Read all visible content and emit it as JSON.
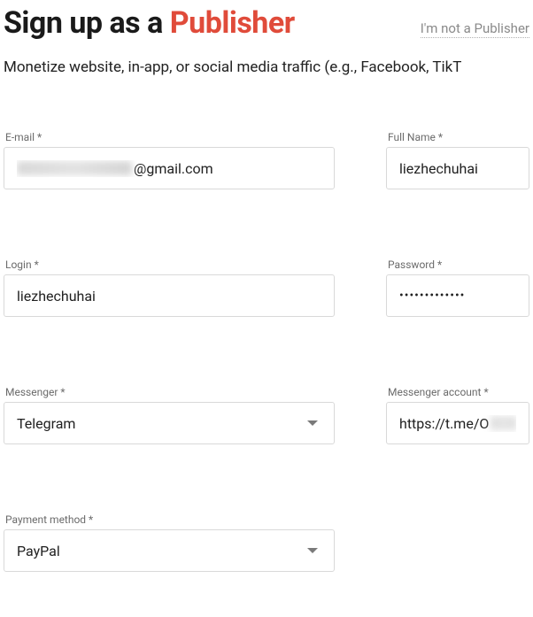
{
  "header": {
    "title_prefix": "Sign up as a ",
    "title_accent": "Publisher",
    "not_publisher_link": "I'm not a Publisher"
  },
  "subtitle": "Monetize website, in-app, or social media traffic (e.g., Facebook, TikT",
  "fields": {
    "email": {
      "label": "E-mail *",
      "value_suffix": "@gmail.com"
    },
    "fullname": {
      "label": "Full Name *",
      "value": "liezhechuhai"
    },
    "login": {
      "label": "Login *",
      "value": "liezhechuhai"
    },
    "password": {
      "label": "Password *",
      "masked": "•••••••••••••"
    },
    "messenger": {
      "label": "Messenger *",
      "value": "Telegram"
    },
    "messenger_account": {
      "label": "Messenger account *",
      "value_prefix": "https://t.me/O"
    },
    "payment_method": {
      "label": "Payment method *",
      "value": "PayPal"
    }
  }
}
